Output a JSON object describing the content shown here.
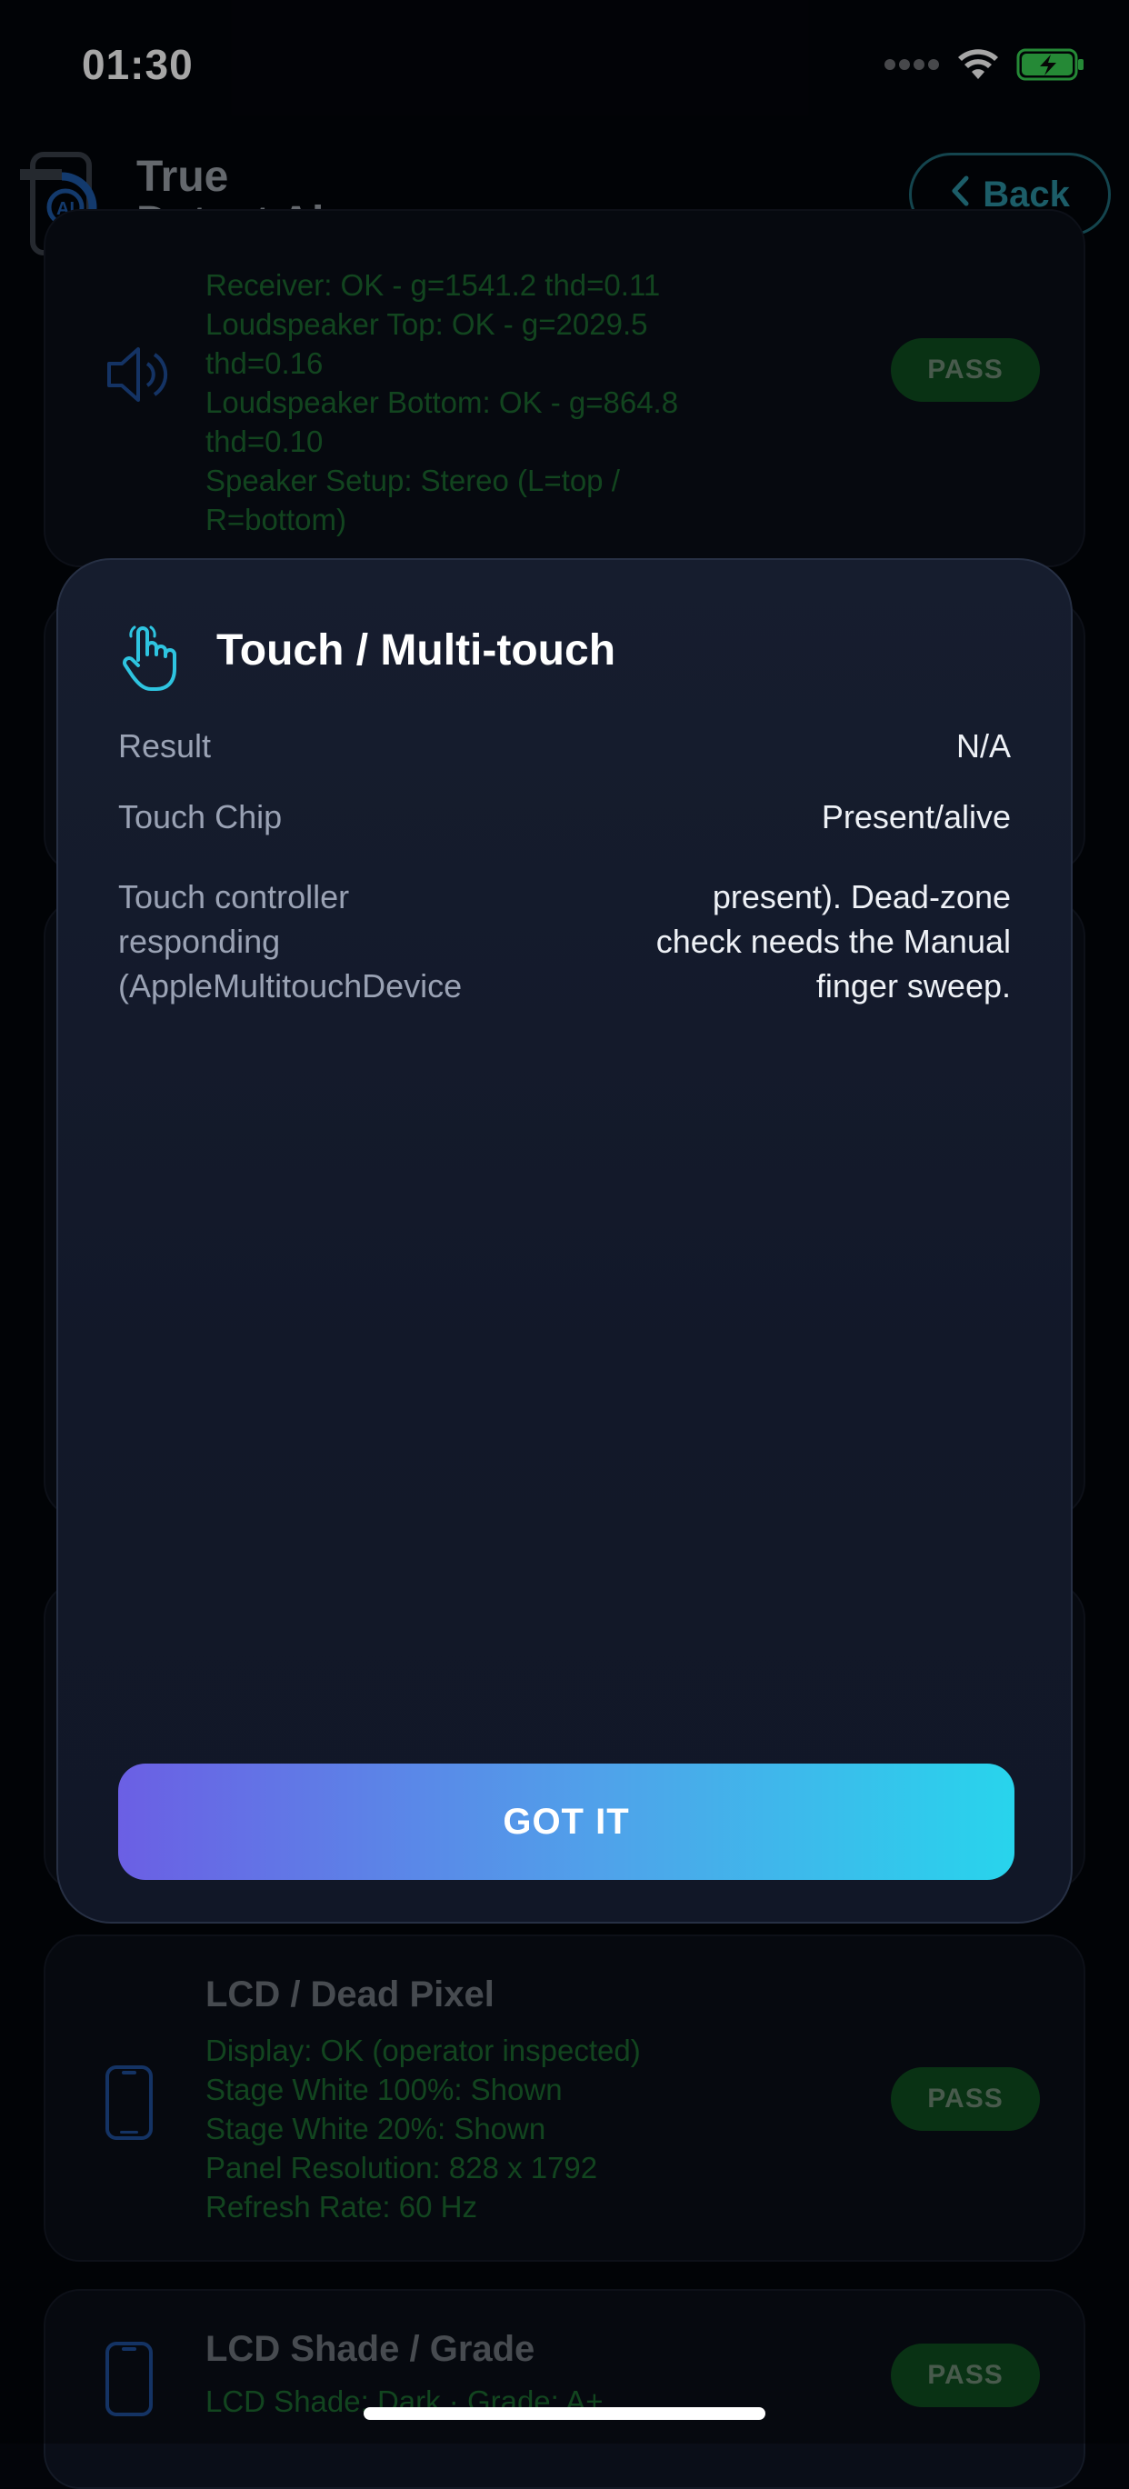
{
  "status_bar": {
    "time": "01:30"
  },
  "header": {
    "brand_line1": "True",
    "brand_line2": "Detect Ai",
    "back_label": "Back",
    "logo_text": "AI"
  },
  "speaker_card": {
    "lines": [
      "Receiver: OK - g=1541.2 thd=0.11",
      "Loudspeaker Top: OK - g=2029.5",
      "thd=0.16",
      "Loudspeaker Bottom: OK - g=864.8",
      "thd=0.10",
      "Speaker Setup: Stereo (L=top /",
      "R=bottom)"
    ],
    "badge": "PASS"
  },
  "modal": {
    "title": "Touch / Multi-touch",
    "rows": [
      {
        "label": "Result",
        "value": "N/A"
      },
      {
        "label": "Touch Chip",
        "value": "Present/alive"
      }
    ],
    "detail_label_lines": [
      "Touch controller",
      "responding",
      "(AppleMultitouchDevice"
    ],
    "detail_value_lines": [
      "present). Dead-zone",
      "check needs the Manual",
      "finger sweep."
    ],
    "button_label": "GOT IT"
  },
  "lcd_card": {
    "title": "LCD / Dead Pixel",
    "lines": [
      "Display: OK (operator inspected)",
      "Stage White 100%: Shown",
      "Stage White 20%: Shown",
      "Panel Resolution: 828 x 1792",
      "Refresh Rate: 60 Hz"
    ],
    "badge": "PASS"
  },
  "lcd_shade_card": {
    "title": "LCD Shade / Grade",
    "line": "LCD Shade: Dark  ·  Grade: A+",
    "badge": "PASS"
  },
  "colors": {
    "accent_cyan": "#28d4ec",
    "accent_purple": "#6b5fe4",
    "pass_green": "#0f4d1f",
    "card_text_green": "#1c6b30"
  }
}
